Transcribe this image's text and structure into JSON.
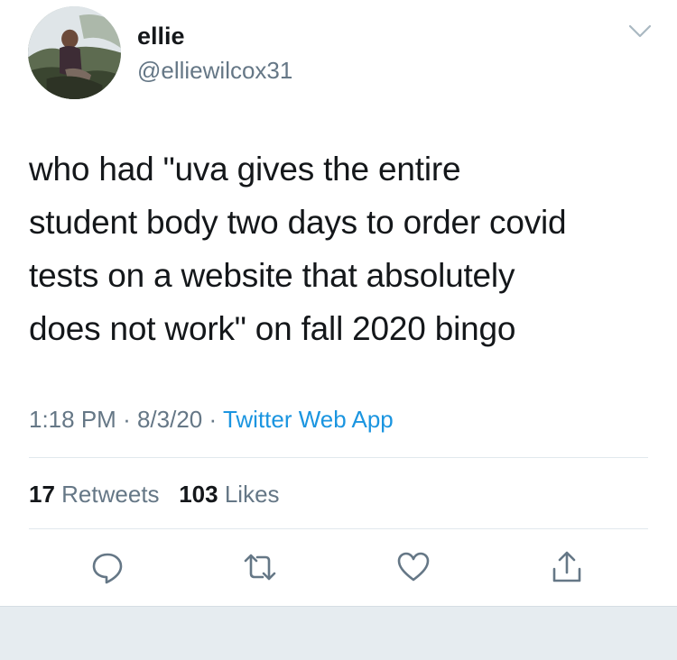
{
  "user": {
    "display_name": "ellie",
    "handle": "@elliewilcox31"
  },
  "tweet": {
    "lines": [
      "who had \"uva gives the entire",
      "student body two days to order covid",
      "tests on a website that absolutely",
      "does not work\" on fall 2020 bingo"
    ],
    "time": "1:18 PM",
    "date": "8/3/20",
    "separator": "·",
    "source": "Twitter Web App"
  },
  "stats": {
    "retweets_count": "17",
    "retweets_label": "Retweets",
    "likes_count": "103",
    "likes_label": "Likes"
  },
  "icons": {
    "menu": "chevron-down-icon",
    "reply": "reply-icon",
    "retweet": "retweet-icon",
    "like": "heart-icon",
    "share": "share-icon"
  },
  "colors": {
    "text": "#14171a",
    "secondary": "#657786",
    "link": "#1b95e0",
    "divider": "#e1e8ed"
  }
}
